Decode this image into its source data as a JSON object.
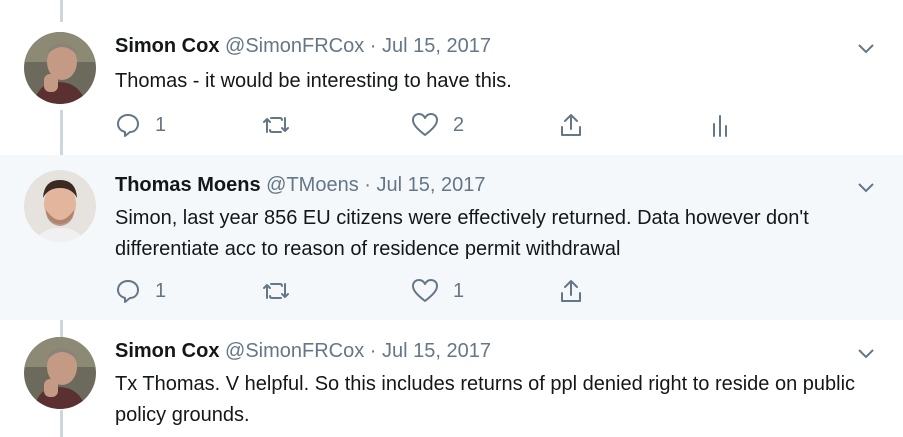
{
  "tweets": [
    {
      "display_name": "Simon Cox",
      "handle": "@SimonFRCox",
      "separator": "·",
      "date": "Jul 15, 2017",
      "text": "Thomas - it would be interesting to have this.",
      "reply_count": "1",
      "retweet_count": "",
      "like_count": "2",
      "show_analytics": true
    },
    {
      "display_name": "Thomas Moens",
      "handle": "@TMoens",
      "separator": "·",
      "date": "Jul 15, 2017",
      "text": "Simon, last year 856 EU citizens were effectively returned. Data however don't differentiate acc to reason of residence permit withdrawal",
      "reply_count": "1",
      "retweet_count": "",
      "like_count": "1",
      "show_analytics": false
    },
    {
      "display_name": "Simon Cox",
      "handle": "@SimonFRCox",
      "separator": "·",
      "date": "Jul 15, 2017",
      "text": "Tx Thomas. V helpful. So this includes returns of ppl denied right to reside on public policy grounds.",
      "reply_count": "",
      "retweet_count": "",
      "like_count": "",
      "show_analytics": false
    }
  ],
  "icons": {
    "reply": "reply-icon",
    "retweet": "retweet-icon",
    "like": "heart-icon",
    "share": "share-icon",
    "analytics": "analytics-icon",
    "caret": "chevron-down-icon"
  },
  "colors": {
    "text": "#14171a",
    "secondary": "#657786",
    "thread_line": "#ccd6dd",
    "highlight_bg": "#f5f8fa"
  }
}
